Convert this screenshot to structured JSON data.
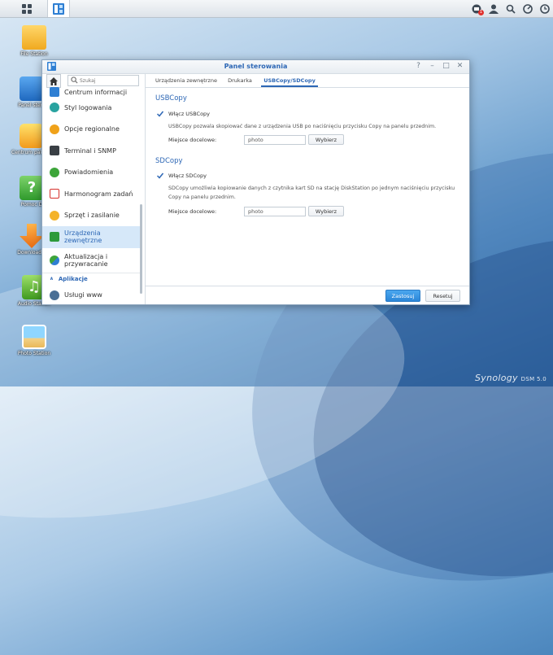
{
  "taskbar": {
    "grid_icon": "apps-grid-icon",
    "open_app_icon": "control-panel-icon",
    "notification_count": "1",
    "right_icons": [
      "notifications-icon",
      "user-icon",
      "search-icon",
      "widgets-icon",
      "clock-icon"
    ]
  },
  "desktop": {
    "icons": [
      {
        "label": "File Station",
        "icon": "folder-icon"
      },
      {
        "label": "Panel stero",
        "icon": "control-panel-icon"
      },
      {
        "label": "Centrum pakietó",
        "icon": "package-center-icon"
      },
      {
        "label": "Pomoc D",
        "icon": "help-icon"
      },
      {
        "label": "Download S",
        "icon": "download-icon"
      },
      {
        "label": "Audio Station",
        "icon": "music-icon"
      },
      {
        "label": "Photo Station",
        "icon": "photo-icon"
      }
    ],
    "brand": "Synology",
    "brand_version": "DSM 5.0"
  },
  "window": {
    "title": "Panel sterowania",
    "controls": [
      "?",
      "–",
      "□",
      "✕"
    ]
  },
  "sidebar": {
    "search_placeholder": "Szukaj",
    "items": [
      {
        "label": "Centrum informacji",
        "icon": "info-center-icon"
      },
      {
        "label": "Styl logowania",
        "icon": "login-style-icon"
      },
      {
        "label": "Opcje regionalne",
        "icon": "regional-options-icon"
      },
      {
        "label": "Terminal i SNMP",
        "icon": "terminal-icon"
      },
      {
        "label": "Powiadomienia",
        "icon": "notification-icon"
      },
      {
        "label": "Harmonogram zadań",
        "icon": "task-scheduler-icon"
      },
      {
        "label": "Sprzęt i zasilanie",
        "icon": "hardware-power-icon"
      },
      {
        "label": "Urządzenia zewnętrzne",
        "icon": "external-devices-icon"
      },
      {
        "label": "Aktualizacja i przywracanie",
        "icon": "update-restore-icon"
      }
    ],
    "section_apps": "Aplikacje",
    "app_items": [
      {
        "label": "Usługi www",
        "icon": "web-services-icon"
      }
    ],
    "active_index": 7
  },
  "tabs": [
    "Urządzenia zewnętrzne",
    "Drukarka",
    "USBCopy/SDCopy"
  ],
  "active_tab": 2,
  "usbcopy": {
    "title": "USBCopy",
    "checkbox_label": "Włącz USBCopy",
    "checked": true,
    "description": "USBCopy pozwala skopiować dane z urządzenia USB po naciśnięciu przycisku Copy na panelu przednim.",
    "dest_label": "Miejsce docelowe:",
    "dest_value": "photo",
    "browse_label": "Wybierz"
  },
  "sdcopy": {
    "title": "SDCopy",
    "checkbox_label": "Włącz SDCopy",
    "checked": true,
    "description": "SDCopy umożliwia kopiowanie danych z czytnika kart SD na stację DiskStation po jednym naciśnięciu przycisku Copy na panelu przednim.",
    "dest_label": "Miejsce docelowe:",
    "dest_value": "photo",
    "browse_label": "Wybierz"
  },
  "footer": {
    "apply_label": "Zastosuj",
    "reset_label": "Resetuj"
  },
  "colors": {
    "accent": "#2d67b5",
    "apply_button": "#2b86d8",
    "active_item_bg": "#d6e8f9"
  }
}
